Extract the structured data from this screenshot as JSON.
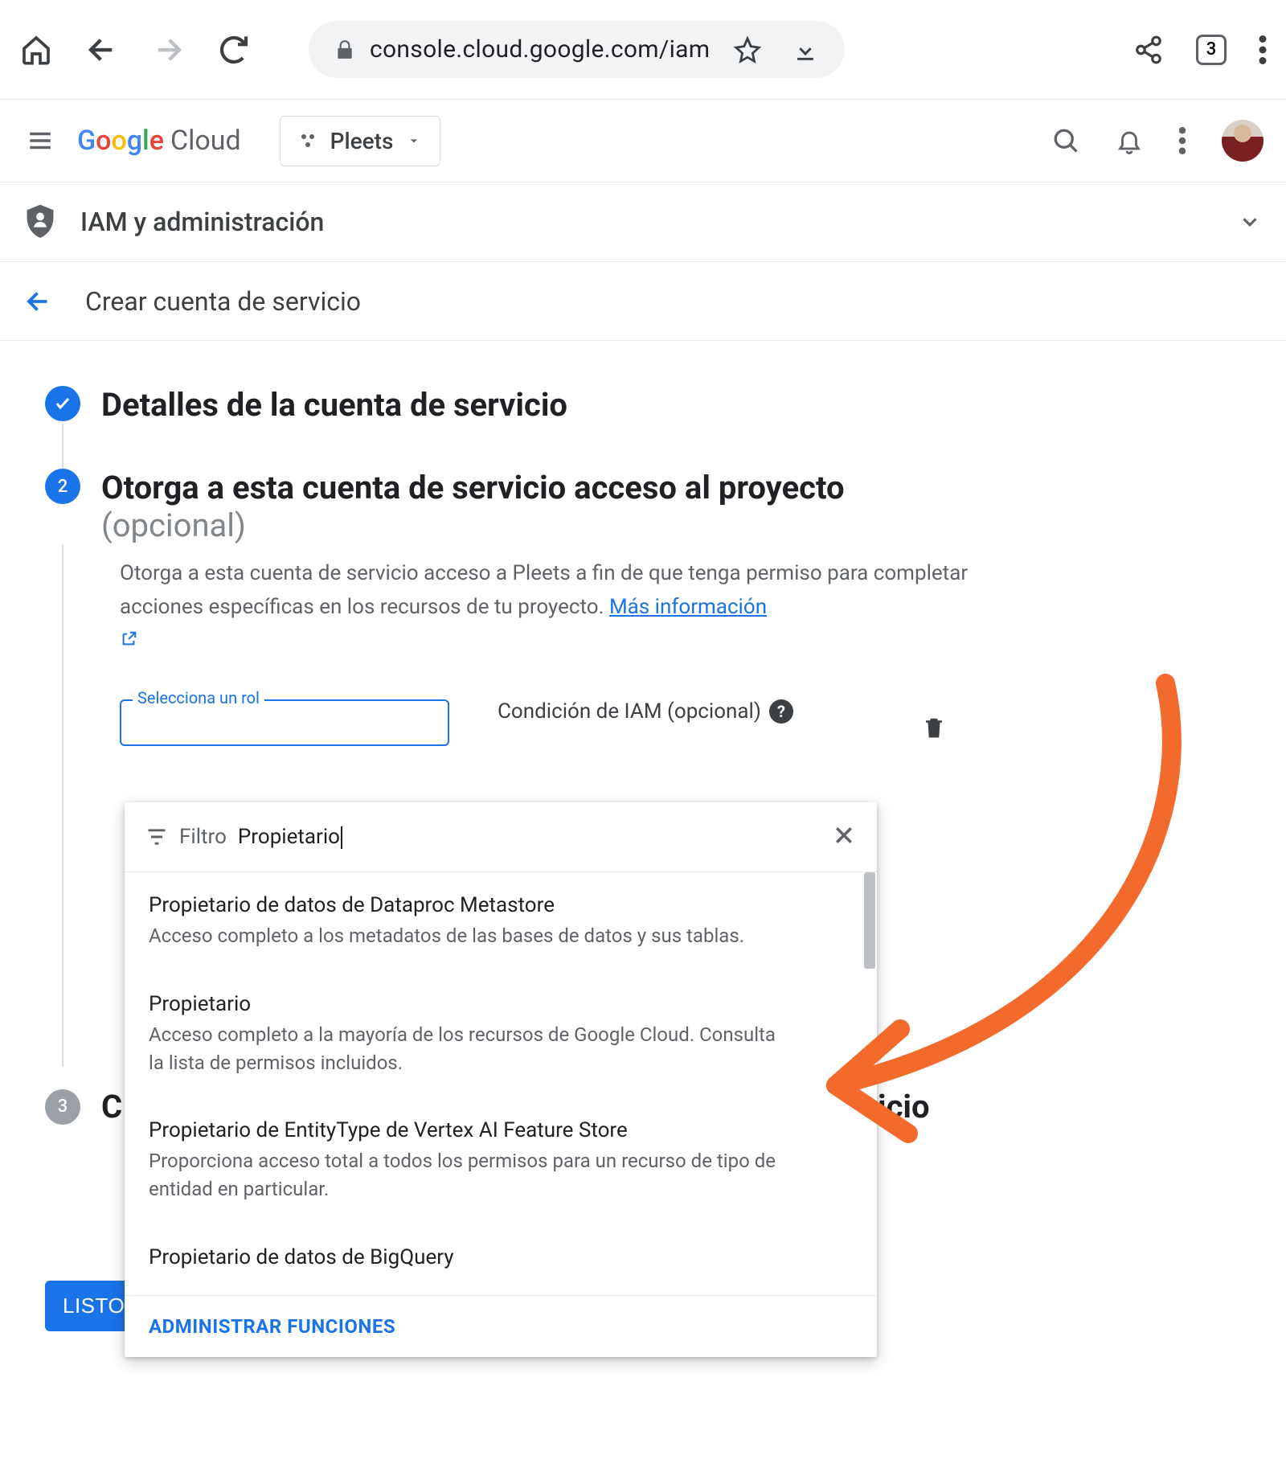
{
  "browser": {
    "url": "console.cloud.google.com/iam",
    "tab_count": "3"
  },
  "header": {
    "logo_google": "Google",
    "logo_cloud": "Cloud",
    "project": "Pleets"
  },
  "section": {
    "title": "IAM y administración",
    "sub_title": "Crear cuenta de servicio"
  },
  "steps": {
    "s1": {
      "title": "Detalles de la cuenta de servicio"
    },
    "s2": {
      "num": "2",
      "title": "Otorga a esta cuenta de servicio acceso al proyecto",
      "subtitle": "(opcional)",
      "body_text": "Otorga a esta cuenta de servicio acceso a Pleets a fin de que tenga permiso para completar acciones específicas en los recursos de tu proyecto. ",
      "learn_more": "Más información",
      "role_label": "Selecciona un rol",
      "iam_condition": "Condición de IAM (opcional)"
    },
    "s3": {
      "num": "3",
      "title_left": "C",
      "title_right": "icio"
    }
  },
  "dropdown": {
    "filter_label": "Filtro",
    "filter_value": "Propietario",
    "items": [
      {
        "title": "Propietario de datos de Dataproc Metastore",
        "desc": "Acceso completo a los metadatos de las bases de datos y sus tablas."
      },
      {
        "title": "Propietario",
        "desc": "Acceso completo a la mayoría de los recursos de Google Cloud. Consulta la lista de permisos incluidos."
      },
      {
        "title": "Propietario de EntityType de Vertex AI Feature Store",
        "desc": "Proporciona acceso total a todos los permisos para un recurso de tipo de entidad en particular."
      },
      {
        "title": "Propietario de datos de BigQuery",
        "desc": ""
      }
    ],
    "footer": "ADMINISTRAR FUNCIONES"
  },
  "buttons": {
    "listo": "LISTO"
  }
}
